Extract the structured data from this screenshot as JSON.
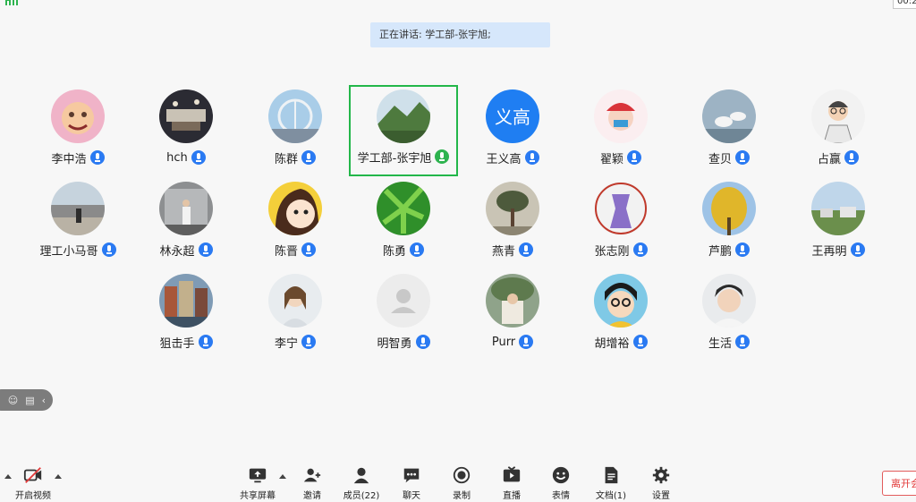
{
  "header": {
    "timer": "00:2",
    "speaking_label": "正在讲话: 学工部-张宇旭;"
  },
  "participants": [
    {
      "name": "李中浩"
    },
    {
      "name": "hch"
    },
    {
      "name": "陈群"
    },
    {
      "name": "学工部-张宇旭"
    },
    {
      "name": "王义高",
      "avatar_text": "义高"
    },
    {
      "name": "翟颖"
    },
    {
      "name": "查贝"
    },
    {
      "name": "占赢"
    },
    {
      "name": "理工小马哥"
    },
    {
      "name": "林永超"
    },
    {
      "name": "陈晋"
    },
    {
      "name": "陈勇"
    },
    {
      "name": "燕青"
    },
    {
      "name": "张志刚"
    },
    {
      "name": "芦鹏"
    },
    {
      "name": "王再明"
    },
    {
      "name": "狙击手"
    },
    {
      "name": "李宁"
    },
    {
      "name": "明智勇"
    },
    {
      "name": "Purr"
    },
    {
      "name": "胡增裕"
    },
    {
      "name": "生活"
    }
  ],
  "toolbar": {
    "video": "开启视频",
    "share": "共享屏幕",
    "invite": "邀请",
    "members": "成员(22)",
    "chat": "聊天",
    "record": "录制",
    "live": "直播",
    "reaction": "表情",
    "docs": "文档(1)",
    "settings": "设置",
    "leave": "离开会"
  },
  "colors": {
    "accent": "#2a7af2",
    "speaking_green": "#23b74a",
    "banner": "#d6e7fb",
    "leave_red": "#e23a3a"
  }
}
